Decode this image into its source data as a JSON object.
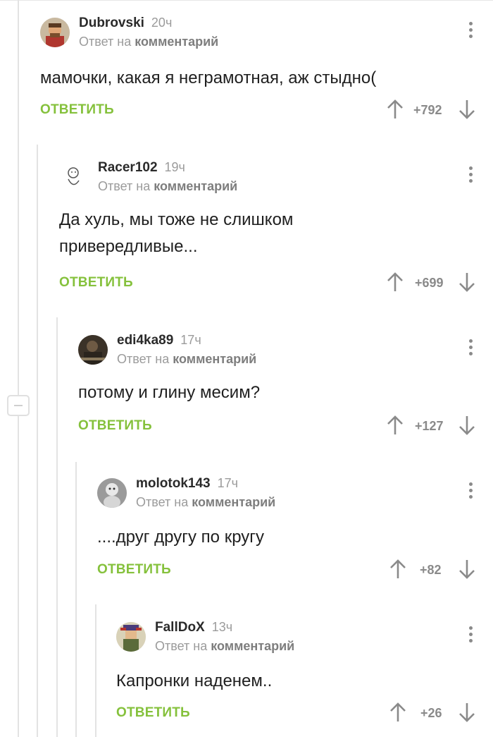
{
  "reply_prefix": "Ответ на",
  "reply_target": "комментарий",
  "answer_label": "ОТВЕТИТЬ",
  "accent_color": "#85c13c",
  "comments": [
    {
      "author": "Dubrovski",
      "time": "20ч",
      "text": "мамочки, какая я неграмотная, аж стыдно(",
      "score": "+792",
      "avatar_icon": "bearded-man-avatar"
    },
    {
      "author": "Racer102",
      "time": "19ч",
      "text": "Да хуль, мы тоже не слишком привередливые...",
      "score": "+699",
      "avatar_icon": "baby-sketch-avatar"
    },
    {
      "author": "edi4ka89",
      "time": "17ч",
      "text": "потому и глину месим?",
      "score": "+127",
      "avatar_icon": "dark-photo-avatar"
    },
    {
      "author": "molotok143",
      "time": "17ч",
      "text": "....друг другу по кругу",
      "score": "+82",
      "avatar_icon": "baby-photo-avatar"
    },
    {
      "author": "FallDoX",
      "time": "13ч",
      "text": "Капронки наденем..",
      "score": "+26",
      "avatar_icon": "pixel-character-avatar"
    }
  ]
}
